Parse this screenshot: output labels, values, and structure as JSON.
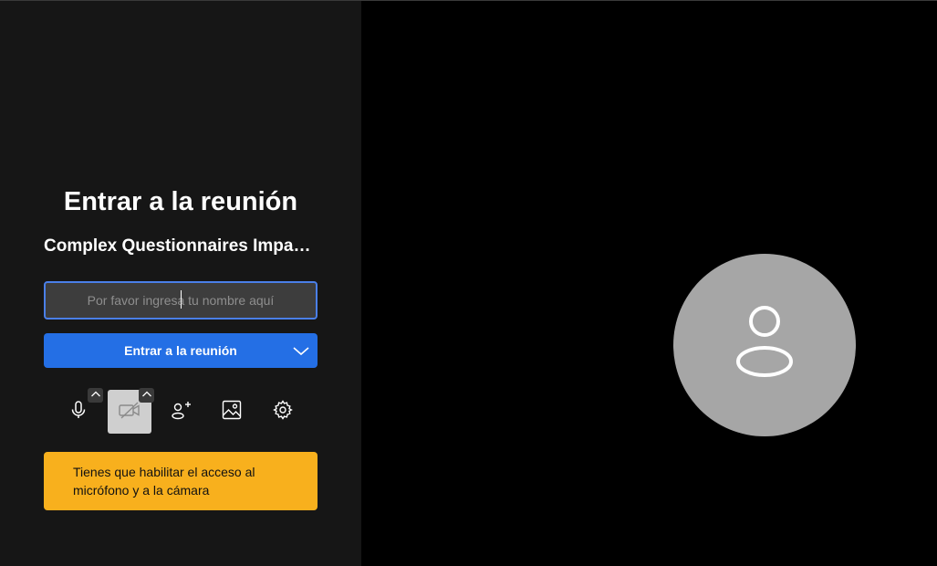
{
  "prejoin": {
    "title": "Entrar a la reunión",
    "meeting_name": "Complex Questionnaires Impact Non-Response Rates",
    "name_input": {
      "placeholder": "Por favor ingresa tu nombre aquí",
      "value": ""
    },
    "join_button_label": "Entrar a la reunión",
    "warning_text": "Tienes que habilitar el acceso al micrófono y a la cámara"
  },
  "toolbar": {
    "buttons": [
      {
        "name": "microphone",
        "icon": "microphone-icon"
      },
      {
        "name": "camera",
        "icon": "camera-off-icon",
        "state": "active"
      },
      {
        "name": "invite",
        "icon": "add-person-icon"
      },
      {
        "name": "background",
        "icon": "image-icon"
      },
      {
        "name": "settings",
        "icon": "gear-icon"
      }
    ]
  },
  "colors": {
    "left_panel_bg": "#161616",
    "accent": "#246fe5",
    "warning": "#f8b01d",
    "avatar_bg": "#a6a6a6"
  }
}
